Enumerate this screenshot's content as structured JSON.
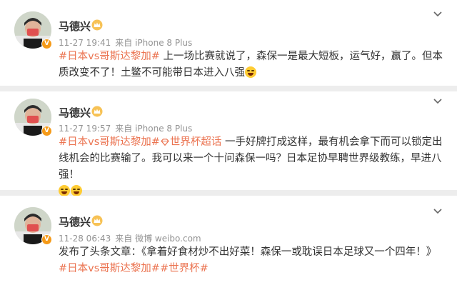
{
  "posts": [
    {
      "user": "马德兴",
      "time": "11-27 19:41",
      "source": "来自 iPhone 8 Plus",
      "tag1": "#日本vs哥斯达黎加#",
      "text": " 上一场比赛就说了，森保一是最大短板，运气好，赢了。但本质改变不了！土鳖不可能带日本进入八强"
    },
    {
      "user": "马德兴",
      "time": "11-27 19:57",
      "source": "来自 iPhone 8 Plus",
      "tag1": "#日本vs哥斯达黎加#",
      "tag2": "世界杯超话",
      "text": " 一手好牌打成这样，最有机会拿下而可以锁定出线机会的比赛输了。我可以来一个十问森保一吗？日本足协早聘世界级教练，早进八强！"
    },
    {
      "user": "马德兴",
      "time": "11-28 06:43",
      "source": "来自 微博 weibo.com",
      "text": "发布了头条文章：《拿着好食材炒不出好菜！森保一或耽误日本足球又一个四年！》",
      "tag1": "#日本vs哥斯达黎加#",
      "tag2": "#世界杯#"
    }
  ],
  "colors": {
    "topic": "#eb7350",
    "verified": "#f59a18",
    "meta": "#939393"
  }
}
